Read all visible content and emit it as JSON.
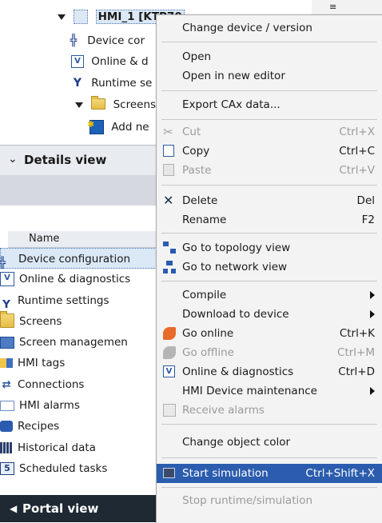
{
  "tree": {
    "items": [
      {
        "label": "HMI_1 [KTP70"
      },
      {
        "label": "Device cor"
      },
      {
        "label": "Online & d"
      },
      {
        "label": "Runtime se"
      },
      {
        "label": "Screens"
      },
      {
        "label": "Add ne"
      }
    ]
  },
  "details": {
    "title": "Details view",
    "column_name": "Name",
    "items": [
      {
        "label": "Device configuration"
      },
      {
        "label": "Online & diagnostics"
      },
      {
        "label": "Runtime settings"
      },
      {
        "label": "Screens"
      },
      {
        "label": "Screen managemen"
      },
      {
        "label": "HMI tags"
      },
      {
        "label": "Connections"
      },
      {
        "label": "HMI alarms"
      },
      {
        "label": "Recipes"
      },
      {
        "label": "Historical data"
      },
      {
        "label": "Scheduled tasks"
      }
    ]
  },
  "portal": {
    "label": "Portal view"
  },
  "menu": {
    "change_device": "Change device / version",
    "open": "Open",
    "open_new": "Open in new editor",
    "export_cax": "Export CAx data...",
    "cut": "Cut",
    "cut_sc": "Ctrl+X",
    "copy": "Copy",
    "copy_sc": "Ctrl+C",
    "paste": "Paste",
    "paste_sc": "Ctrl+V",
    "delete": "Delete",
    "delete_sc": "Del",
    "rename": "Rename",
    "rename_sc": "F2",
    "topology": "Go to topology view",
    "network": "Go to network view",
    "compile": "Compile",
    "download": "Download to device",
    "go_online": "Go online",
    "go_online_sc": "Ctrl+K",
    "go_offline": "Go offline",
    "go_offline_sc": "Ctrl+M",
    "online_diag": "Online & diagnostics",
    "online_diag_sc": "Ctrl+D",
    "hmi_maint": "HMI Device maintenance",
    "receive_alarms": "Receive alarms",
    "change_color": "Change object color",
    "start_sim": "Start simulation",
    "start_sim_sc": "Ctrl+Shift+X",
    "stop_sim": "Stop runtime/simulation"
  },
  "colors": {
    "highlight": "#2b5cae",
    "portal_bar": "#1f2933"
  }
}
